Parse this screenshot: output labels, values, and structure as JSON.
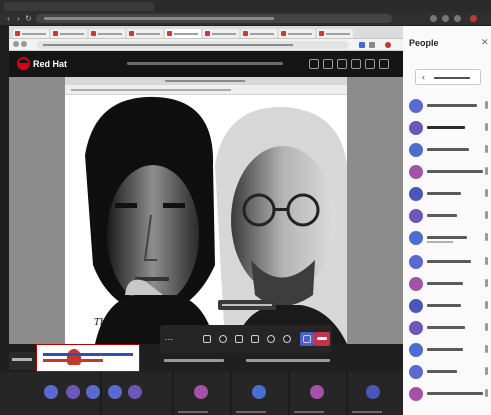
{
  "share": {
    "brand": "Red Hat",
    "caption": "The people who are"
  },
  "people_panel": {
    "title": "People"
  },
  "colors": {
    "brand_red": "#d9001b",
    "teams_purple": "#5b6ad0",
    "leave_red": "#c4314b"
  },
  "icons": [
    "close-icon",
    "chevron-left-icon",
    "more-options-icon",
    "camera-icon",
    "microphone-icon",
    "share-icon",
    "raise-hand-icon",
    "leave-call-icon"
  ]
}
